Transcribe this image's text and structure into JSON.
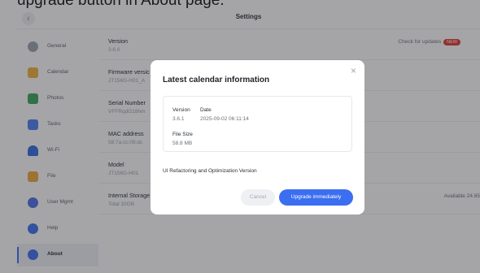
{
  "caption": "upgrade button in About page.",
  "header": {
    "title": "Settings",
    "back_icon": "‹"
  },
  "sidebar": {
    "items": [
      {
        "label": "General",
        "icon": "gear-icon",
        "color": "#9ca3ad"
      },
      {
        "label": "Calendar",
        "icon": "calendar-icon",
        "color": "#f2b23a"
      },
      {
        "label": "Photos",
        "icon": "photos-icon",
        "color": "#3aa65c"
      },
      {
        "label": "Tasks",
        "icon": "tasks-icon",
        "color": "#4a7ef2"
      },
      {
        "label": "Wi-Fi",
        "icon": "wifi-icon",
        "color": "#2f6de0"
      },
      {
        "label": "File",
        "icon": "folder-icon",
        "color": "#f2a93a"
      },
      {
        "label": "User Mgmt",
        "icon": "user-icon",
        "color": "#4f6de8"
      },
      {
        "label": "Help",
        "icon": "help-icon",
        "color": "#3b6ef0"
      },
      {
        "label": "About",
        "icon": "info-icon",
        "color": "#3b6ef0"
      }
    ]
  },
  "main": {
    "rows": [
      {
        "key": "Version",
        "value": "3.6.0",
        "right": "Check for updates",
        "badge": "NEW"
      },
      {
        "key": "Firmware versic",
        "value": "JT156G-H01_A",
        "right": ""
      },
      {
        "key": "Serial Number",
        "value": "VFFRqdG18hm",
        "right": ""
      },
      {
        "key": "MAC address",
        "value": "58:7a:cc:09:dc",
        "right": ""
      },
      {
        "key": "Model",
        "value": "JT156G-H01",
        "right": ""
      },
      {
        "key": "Internal Storage",
        "value": "Total 32GB",
        "right": "Available 24.65"
      }
    ]
  },
  "dialog": {
    "title": "Latest calendar information",
    "close": "×",
    "version_label": "Version",
    "version_value": "3.6.1",
    "date_label": "Date",
    "date_value": "2025-09-02 06:11:14",
    "size_label": "File Size",
    "size_value": "58.8 MB",
    "description": "UI Refactoring and Optimization Version",
    "cancel_label": "Cancel",
    "upgrade_label": "Upgrade immediately"
  },
  "colors": {
    "accent": "#3b6ef0",
    "badge": "#e0382f"
  }
}
